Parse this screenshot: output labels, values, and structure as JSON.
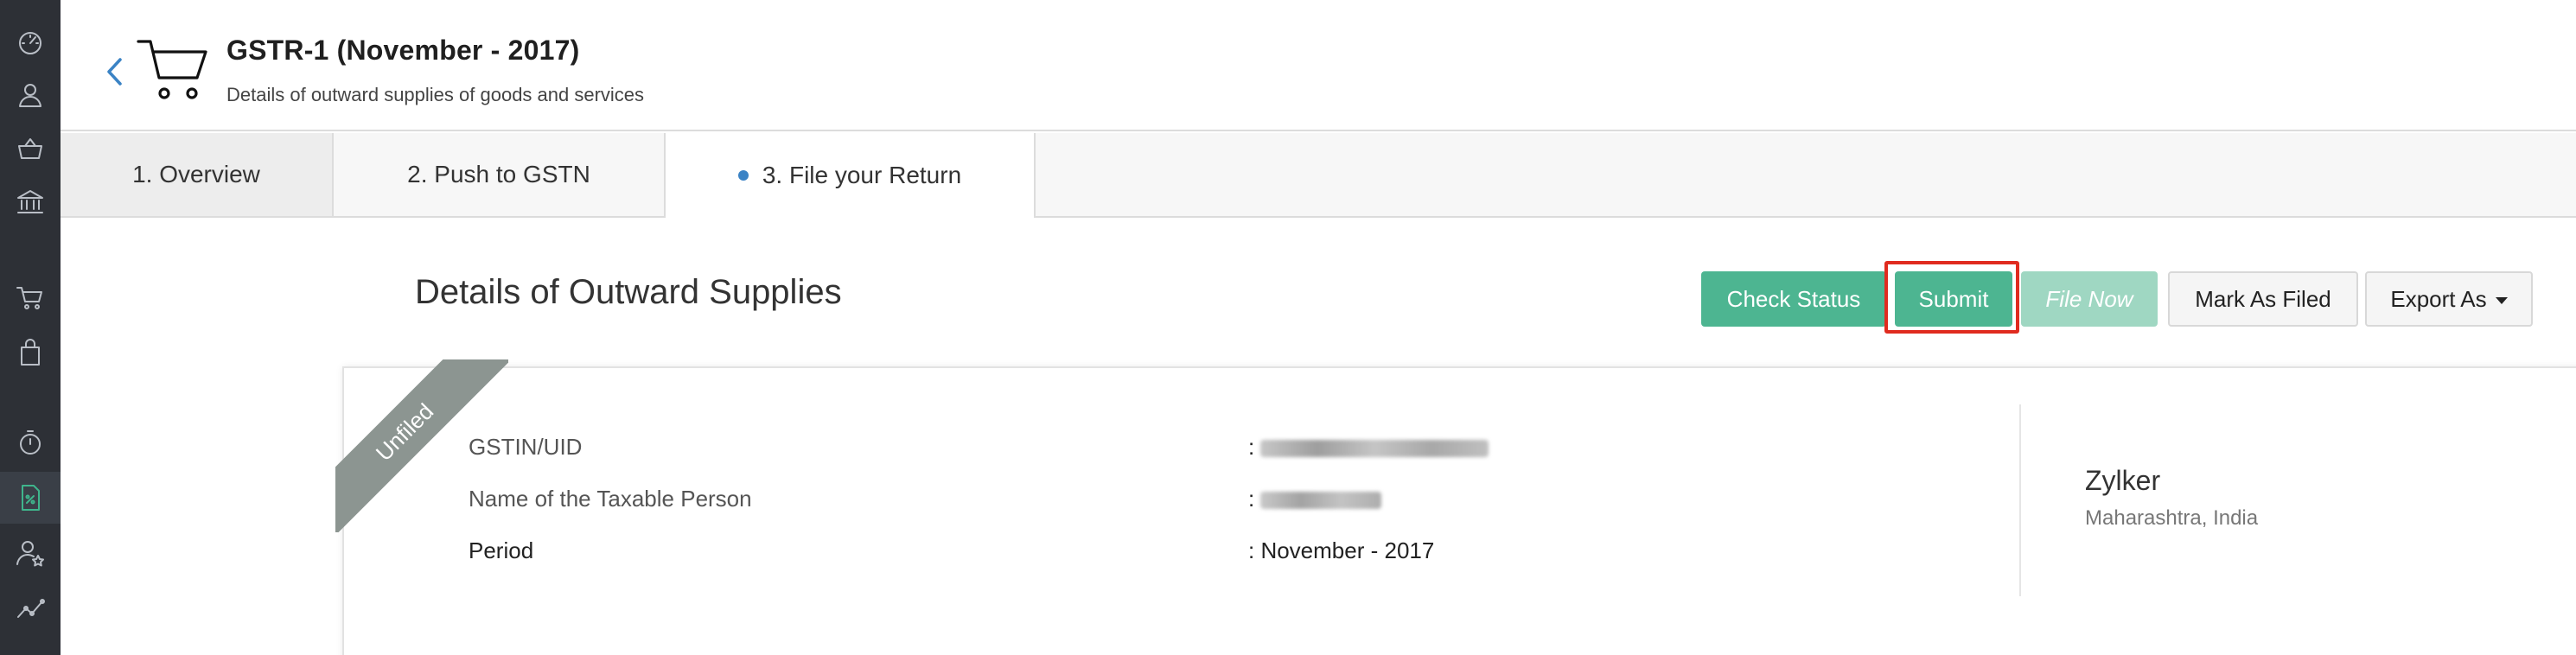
{
  "sidebar": {
    "items": [
      {
        "icon": "dashboard-icon"
      },
      {
        "icon": "contacts-icon"
      },
      {
        "icon": "items-basket-icon"
      },
      {
        "icon": "banking-icon"
      },
      {
        "icon": "sales-cart-icon"
      },
      {
        "icon": "purchases-bag-icon"
      },
      {
        "icon": "time-tracking-icon"
      },
      {
        "icon": "gst-filing-icon",
        "active": true
      },
      {
        "icon": "accountant-icon"
      },
      {
        "icon": "reports-icon"
      }
    ],
    "active_color": "#3fb58c"
  },
  "header": {
    "title": "GSTR-1 (November - 2017)",
    "subtitle": "Details of outward supplies of goods and services"
  },
  "tabs": [
    {
      "label": "1. Overview"
    },
    {
      "label": "2. Push to GSTN"
    },
    {
      "label": "3. File your Return",
      "active": true
    }
  ],
  "main": {
    "section_title": "Details of Outward Supplies",
    "buttons": {
      "check_status": "Check Status",
      "submit": "Submit",
      "file_now": "File Now",
      "mark_as_filed": "Mark As Filed",
      "export_as": "Export As"
    },
    "card": {
      "ribbon": "Unfiled",
      "rows": [
        {
          "label": "GSTIN/UID",
          "value": ":"
        },
        {
          "label": "Name of the Taxable Person",
          "value": ":"
        },
        {
          "label": "Period",
          "value": ": November - 2017"
        }
      ],
      "org": {
        "name": "Zylker",
        "location": "Maharashtra, India"
      }
    }
  },
  "colors": {
    "primary_green": "#4db591",
    "disabled_green": "#9fd7c2",
    "highlight_red": "#e02b1f",
    "link_blue": "#3b83c5"
  }
}
